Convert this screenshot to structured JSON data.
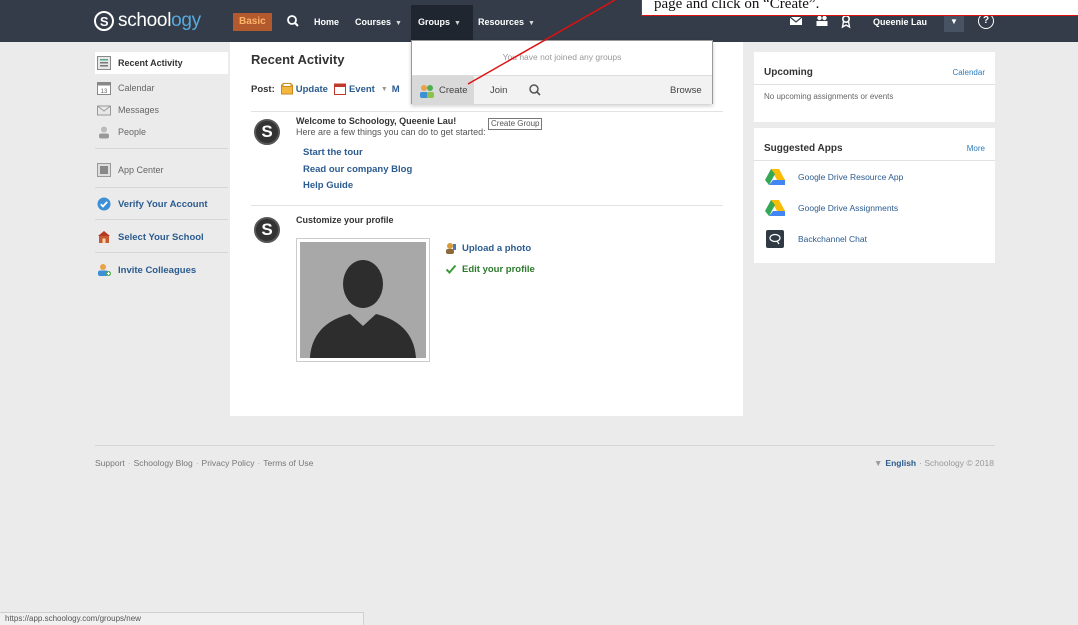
{
  "nav": {
    "logo_prefix": "school",
    "logo_suffix": "ogy",
    "basic": "Basic",
    "home": "Home",
    "courses": "Courses",
    "groups": "Groups",
    "resources": "Resources",
    "user": "Queenie Lau",
    "help": "?"
  },
  "callout": {
    "text": "page and click on “Create”."
  },
  "sidebar": {
    "items": [
      {
        "label": "Recent Activity",
        "icon": "recent-activity-icon"
      },
      {
        "label": "Calendar",
        "icon": "calendar-icon"
      },
      {
        "label": "Messages",
        "icon": "messages-icon"
      },
      {
        "label": "People",
        "icon": "people-icon"
      },
      {
        "label": "App Center",
        "icon": "app-center-icon"
      },
      {
        "label": "Verify Your Account",
        "icon": "verify-check-icon"
      },
      {
        "label": "Select Your School",
        "icon": "school-icon"
      },
      {
        "label": "Invite Colleagues",
        "icon": "invite-icon"
      }
    ]
  },
  "main": {
    "title": "Recent Activity",
    "post_label": "Post:",
    "post_update": "Update",
    "post_event": "Event",
    "post_more": "M",
    "welcome_title": "Welcome to Schoology, Queenie Lau!",
    "welcome_text": "Here are a few things you can do to get started:",
    "links": [
      "Start the tour",
      "Read our company Blog",
      "Help Guide"
    ],
    "customize_title": "Customize your profile",
    "upload_photo": "Upload a photo",
    "edit_profile": "Edit your profile",
    "avatar_letter": "S"
  },
  "dropdown": {
    "empty_text": "You have not joined any groups",
    "create": "Create",
    "join": "Join",
    "browse": "Browse",
    "tooltip": "Create Group"
  },
  "upcoming": {
    "title": "Upcoming",
    "link": "Calendar",
    "text": "No upcoming assignments or events"
  },
  "apps": {
    "title": "Suggested Apps",
    "link": "More",
    "items": [
      "Google Drive Resource App",
      "Google Drive Assignments",
      "Backchannel Chat"
    ]
  },
  "footer": {
    "links": [
      "Support",
      "Schoology Blog",
      "Privacy Policy",
      "Terms of Use"
    ],
    "language": "English",
    "copyright": "Schoology © 2018"
  },
  "statusbar": {
    "url": "https://app.schoology.com/groups/new"
  },
  "colors": {
    "nav_bg": "#333c48",
    "link": "#2b5b8f",
    "basic_badge": "#b25a2d",
    "annotation": "#dd1111"
  }
}
